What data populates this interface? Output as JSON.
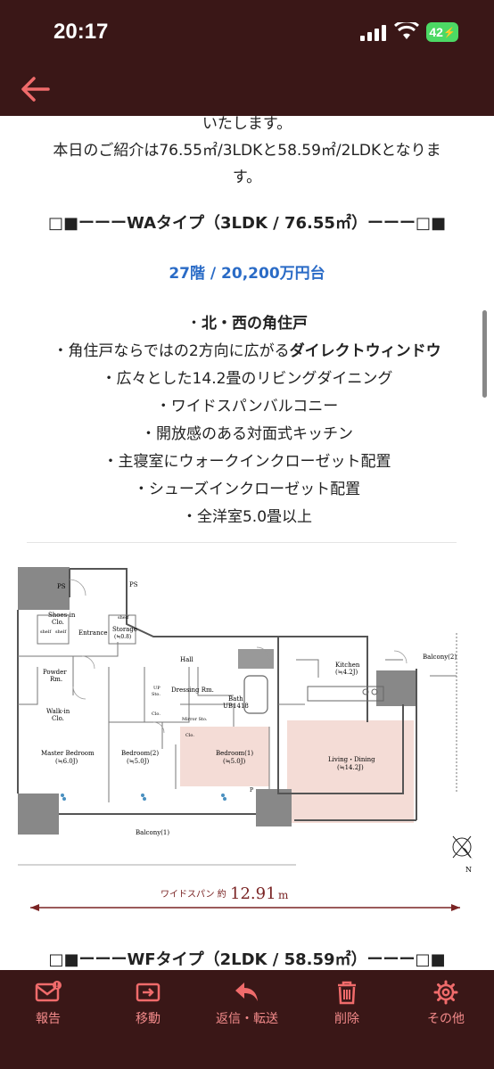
{
  "status_bar": {
    "time": "20:17",
    "battery": "42"
  },
  "content": {
    "intro_line1": "いたします。",
    "intro_line2": "本日のご紹介は76.55㎡/3LDKと58.59㎡/2LDKとなりま",
    "intro_line3": "す。",
    "wa_heading": "□■ーーーWAタイプ（3LDK / 76.55㎡）ーーー□■",
    "wa_price": "27階 / 20,200万円台",
    "features": [
      {
        "pre": "・",
        "text": "北・西の角住戸",
        "bold": ""
      },
      {
        "pre": "・角住戸ならではの2方向に広がる",
        "text": "",
        "bold": "ダイレクトウィンドウ"
      },
      {
        "pre": "・広々とした14.2畳のリビングダイニング",
        "text": "",
        "bold": ""
      },
      {
        "pre": "・ワイドスパンバルコニー",
        "text": "",
        "bold": ""
      },
      {
        "pre": "・開放感のある対面式キッチン",
        "text": "",
        "bold": ""
      },
      {
        "pre": "・主寝室にウォークインクローゼット配置",
        "text": "",
        "bold": ""
      },
      {
        "pre": "・シューズインクローゼット配置",
        "text": "",
        "bold": ""
      },
      {
        "pre": "・全洋室5.0畳以上",
        "text": "",
        "bold": ""
      }
    ],
    "wf_heading": "□■ーーーWFタイプ（2LDK / 58.59㎡）ーーー□■",
    "floorplan": {
      "ps1": "PS",
      "ps2": "PS",
      "shoes1": "Shoes-in",
      "shoes2": "Clo.",
      "shelf1": "shelf",
      "shelf2": "shelf",
      "shelf3": "shelf",
      "entrance": "Entrance",
      "storage1": "Storage",
      "storage2": "(≒0.8)",
      "powder1": "Powder",
      "powder2": "Rm.",
      "hall": "Hall",
      "walkin1": "Walk-in",
      "walkin2": "Clo.",
      "up1": "UP",
      "up2": "Sto.",
      "dressing": "Dressing Rm.",
      "bath1": "Bath",
      "bath2": "UB1418",
      "mirror": "Mirror Sto.",
      "clo1": "Clo.",
      "clo2": "Clo.",
      "master1": "Master Bedroom",
      "master2": "(≒6.0J)",
      "bed2a": "Bedroom(2)",
      "bed2b": "(≒5.0J)",
      "bed1a": "Bedroom(1)",
      "bed1b": "(≒5.0J)",
      "kitchen1": "Kitchen",
      "kitchen2": "(≒4.2J)",
      "balcony2": "Balcony(2)",
      "living1": "Living・Dining",
      "living2": "(≒14.2J)",
      "balcony1": "Balcony(1)",
      "p": "P",
      "north": "N"
    },
    "span_label": "ワイドスパン 約",
    "span_value": "12.91",
    "span_unit": "m"
  },
  "toolbar": {
    "items": [
      {
        "label": "報告",
        "icon": "report-mail-icon"
      },
      {
        "label": "移動",
        "icon": "move-folder-icon"
      },
      {
        "label": "返信・転送",
        "icon": "reply-icon"
      },
      {
        "label": "削除",
        "icon": "trash-icon"
      },
      {
        "label": "その他",
        "icon": "more-icon"
      }
    ]
  },
  "colors": {
    "header_bg": "#3a1717",
    "accent": "#f06b6b",
    "price_blue": "#2a6bc6",
    "floor_pink": "#f4dcd6"
  }
}
